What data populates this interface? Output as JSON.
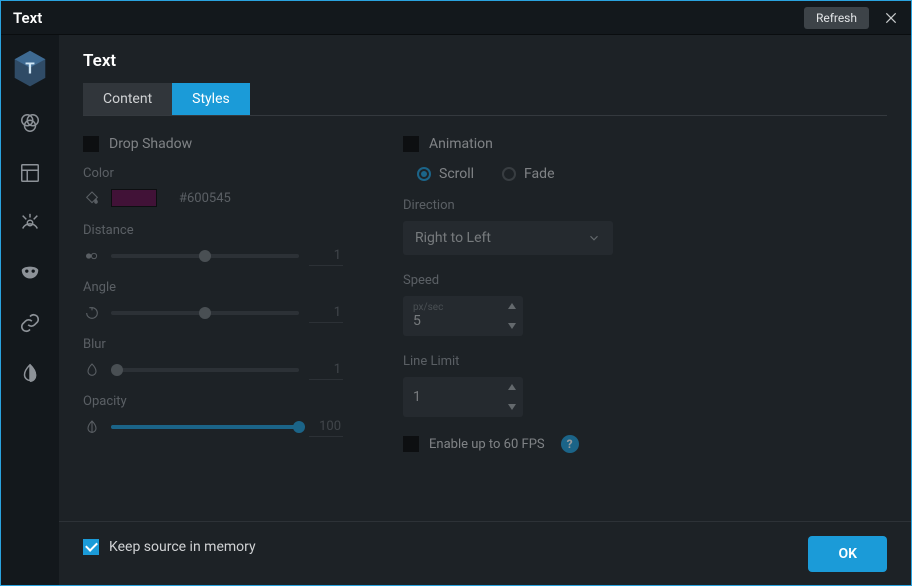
{
  "titlebar": {
    "title": "Text",
    "refresh": "Refresh"
  },
  "panel": {
    "title": "Text",
    "tabs": {
      "content": "Content",
      "styles": "Styles"
    }
  },
  "shadow": {
    "title": "Drop Shadow",
    "color_label": "Color",
    "hex": "#600545",
    "swatch": "#600545",
    "distance_label": "Distance",
    "distance_value": "1",
    "distance_pct": 50,
    "angle_label": "Angle",
    "angle_value": "1",
    "angle_pct": 50,
    "blur_label": "Blur",
    "blur_value": "1",
    "blur_pct": 3,
    "opacity_label": "Opacity",
    "opacity_value": "100",
    "opacity_pct": 100
  },
  "animation": {
    "title": "Animation",
    "scroll": "Scroll",
    "fade": "Fade",
    "direction_label": "Direction",
    "direction_value": "Right to Left",
    "speed_label": "Speed",
    "speed_unit": "px/sec",
    "speed_value": "5",
    "linelimit_label": "Line Limit",
    "linelimit_value": "1",
    "fps_label": "Enable up to 60 FPS"
  },
  "footer": {
    "keep": "Keep source in memory",
    "ok": "OK"
  }
}
